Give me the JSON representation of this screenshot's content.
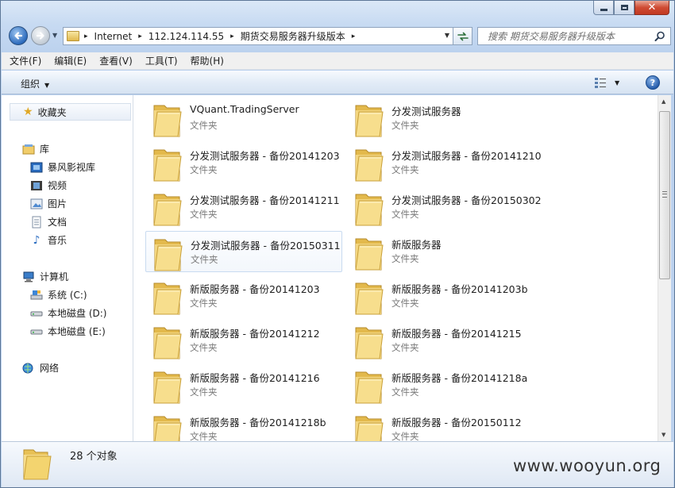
{
  "address_bar": {
    "crumbs": [
      "Internet",
      "112.124.114.55",
      "期货交易服务器升级版本"
    ]
  },
  "search": {
    "placeholder": "搜索 期货交易服务器升级版本"
  },
  "menu": [
    "文件(F)",
    "编辑(E)",
    "查看(V)",
    "工具(T)",
    "帮助(H)"
  ],
  "toolbar": {
    "organize_label": "组织",
    "help_label": "?"
  },
  "navpane": {
    "favorites_label": "收藏夹",
    "library_label": "库",
    "library_items": [
      "暴风影视库",
      "视频",
      "图片",
      "文档",
      "音乐"
    ],
    "computer_label": "计算机",
    "drives": [
      "系统 (C:)",
      "本地磁盘 (D:)",
      "本地磁盘 (E:)"
    ],
    "network_label": "网络"
  },
  "files": [
    {
      "name": "VQuant.TradingServer",
      "type": "文件夹"
    },
    {
      "name": "分发测试服务器",
      "type": "文件夹"
    },
    {
      "name": "分发测试服务器 - 备份20141203",
      "type": "文件夹"
    },
    {
      "name": "分发测试服务器 - 备份20141210",
      "type": "文件夹"
    },
    {
      "name": "分发测试服务器 - 备份20141211",
      "type": "文件夹"
    },
    {
      "name": "分发测试服务器 - 备份20150302",
      "type": "文件夹"
    },
    {
      "name": "分发测试服务器 - 备份20150311",
      "type": "文件夹",
      "selected": true
    },
    {
      "name": "新版服务器",
      "type": "文件夹"
    },
    {
      "name": "新版服务器 - 备份20141203",
      "type": "文件夹"
    },
    {
      "name": "新版服务器 - 备份20141203b",
      "type": "文件夹"
    },
    {
      "name": "新版服务器 - 备份20141212",
      "type": "文件夹"
    },
    {
      "name": "新版服务器 - 备份20141215",
      "type": "文件夹"
    },
    {
      "name": "新版服务器 - 备份20141216",
      "type": "文件夹"
    },
    {
      "name": "新版服务器 - 备份20141218a",
      "type": "文件夹"
    },
    {
      "name": "新版服务器 - 备份20141218b",
      "type": "文件夹"
    },
    {
      "name": "新版服务器 - 备份20150112",
      "type": "文件夹"
    }
  ],
  "status": {
    "item_count": "28 个对象"
  },
  "watermark": "www.wooyun.org"
}
